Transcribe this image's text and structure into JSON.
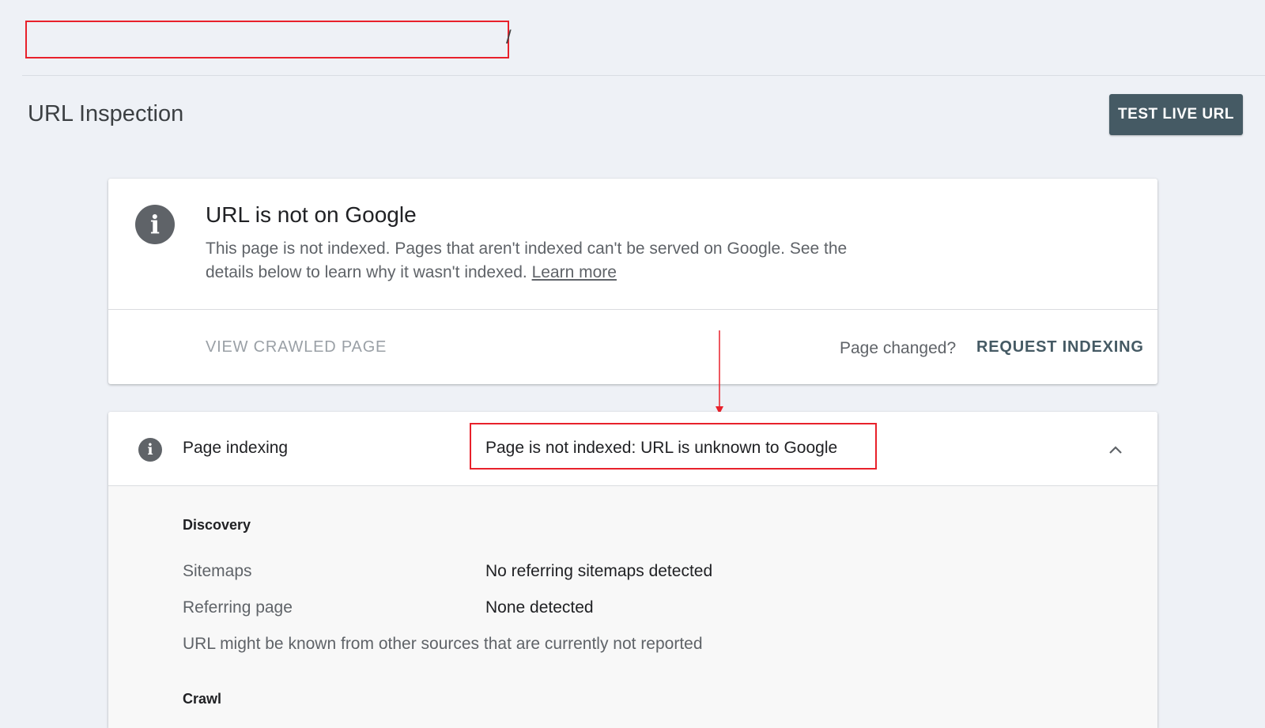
{
  "url_bar": {
    "slash": "/"
  },
  "header": {
    "title": "URL Inspection",
    "test_live_url_label": "TEST LIVE URL"
  },
  "status_card": {
    "icon": "info-icon",
    "title": "URL is not on Google",
    "description": "This page is not indexed. Pages that aren't indexed can't be served on Google. See the details below to learn why it wasn't indexed.",
    "learn_more_label": "Learn more",
    "view_crawled_label": "VIEW CRAWLED PAGE",
    "page_changed_label": "Page changed?",
    "request_indexing_label": "REQUEST INDEXING"
  },
  "indexing_panel": {
    "icon": "info-icon",
    "label": "Page indexing",
    "verdict": "Page is not indexed: URL is unknown to Google",
    "toggle_icon": "chevron-up-icon",
    "discovery": {
      "title": "Discovery",
      "rows": [
        {
          "label": "Sitemaps",
          "value": "No referring sitemaps detected"
        },
        {
          "label": "Referring page",
          "value": "None detected"
        }
      ],
      "note": "URL might be known from other sources that are currently not reported"
    },
    "crawl": {
      "title": "Crawl"
    }
  },
  "colors": {
    "page_bg": "#eef1f6",
    "button_bg": "#455a64",
    "annotation_red": "#e8212b",
    "icon_gray": "#5f6368"
  }
}
